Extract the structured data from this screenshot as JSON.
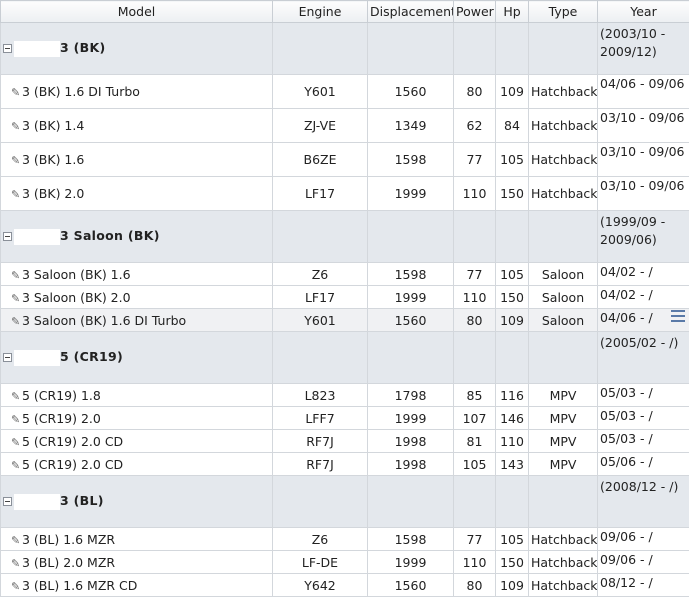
{
  "columns": [
    "Model",
    "Engine",
    "Displacement",
    "Power",
    "Hp",
    "Type",
    "Year"
  ],
  "groups": [
    {
      "name": "3 (BK)",
      "year": "(2003/10 - 2009/12)",
      "row_style": "tall",
      "rows": [
        {
          "model": "3 (BK) 1.6 DI Turbo",
          "engine": "Y601",
          "disp": "1560",
          "power": "80",
          "hp": "109",
          "type": "Hatchback",
          "year": "04/06 - 09/06"
        },
        {
          "model": "3 (BK) 1.4",
          "engine": "ZJ-VE",
          "disp": "1349",
          "power": "62",
          "hp": "84",
          "type": "Hatchback",
          "year": "03/10 - 09/06"
        },
        {
          "model": "3 (BK) 1.6",
          "engine": "B6ZE",
          "disp": "1598",
          "power": "77",
          "hp": "105",
          "type": "Hatchback",
          "year": "03/10 - 09/06"
        },
        {
          "model": "3 (BK) 2.0",
          "engine": "LF17",
          "disp": "1999",
          "power": "110",
          "hp": "150",
          "type": "Hatchback",
          "year": "03/10 - 09/06"
        }
      ]
    },
    {
      "name": "3 Saloon (BK)",
      "year": "(1999/09 - 2009/06)",
      "row_style": "short",
      "rows": [
        {
          "model": "3 Saloon (BK) 1.6",
          "engine": "Z6",
          "disp": "1598",
          "power": "77",
          "hp": "105",
          "type": "Saloon",
          "year": "04/02 - /"
        },
        {
          "model": "3 Saloon (BK) 2.0",
          "engine": "LF17",
          "disp": "1999",
          "power": "110",
          "hp": "150",
          "type": "Saloon",
          "year": "04/02 - /"
        },
        {
          "model": "3 Saloon (BK) 1.6 DI Turbo",
          "engine": "Y601",
          "disp": "1560",
          "power": "80",
          "hp": "109",
          "type": "Saloon",
          "year": "04/06 - /",
          "hover": true
        }
      ]
    },
    {
      "name": "5 (CR19)",
      "year": "(2005/02 - /)",
      "row_style": "short",
      "rows": [
        {
          "model": "5 (CR19) 1.8",
          "engine": "L823",
          "disp": "1798",
          "power": "85",
          "hp": "116",
          "type": "MPV",
          "year": "05/03 - /"
        },
        {
          "model": "5 (CR19) 2.0",
          "engine": "LFF7",
          "disp": "1999",
          "power": "107",
          "hp": "146",
          "type": "MPV",
          "year": "05/03 - /"
        },
        {
          "model": "5 (CR19) 2.0 CD",
          "engine": "RF7J",
          "disp": "1998",
          "power": "81",
          "hp": "110",
          "type": "MPV",
          "year": "05/03 - /"
        },
        {
          "model": "5 (CR19) 2.0 CD",
          "engine": "RF7J",
          "disp": "1998",
          "power": "105",
          "hp": "143",
          "type": "MPV",
          "year": "05/06 - /"
        }
      ]
    },
    {
      "name": "3 (BL)",
      "year": "(2008/12 - /)",
      "row_style": "short",
      "rows": [
        {
          "model": "3 (BL) 1.6 MZR",
          "engine": "Z6",
          "disp": "1598",
          "power": "77",
          "hp": "105",
          "type": "Hatchback",
          "year": "09/06 - /"
        },
        {
          "model": "3 (BL) 2.0 MZR",
          "engine": "LF-DE",
          "disp": "1999",
          "power": "110",
          "hp": "150",
          "type": "Hatchback",
          "year": "09/06 - /"
        },
        {
          "model": "3 (BL) 1.6 MZR CD",
          "engine": "Y642",
          "disp": "1560",
          "power": "80",
          "hp": "109",
          "type": "Hatchback",
          "year": "08/12 - /"
        }
      ]
    }
  ]
}
